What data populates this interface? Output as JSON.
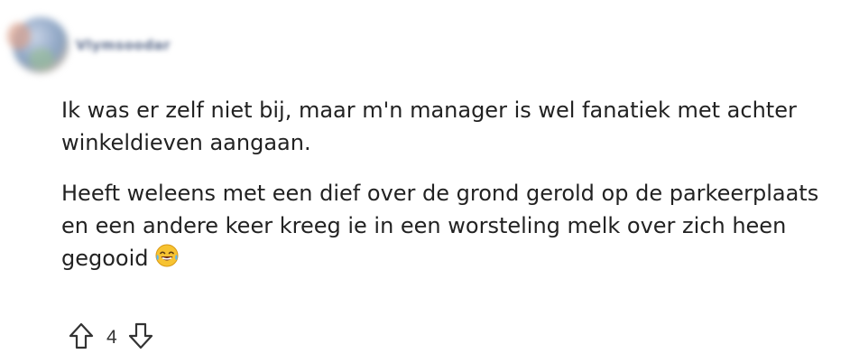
{
  "comment": {
    "author": {
      "username": "Vlymsoodar",
      "avatar_icon": "user-avatar-icon"
    },
    "paragraphs": [
      "Ik was er zelf niet bij, maar m'n manager is wel fanatiek met achter winkeldieven aangaan.",
      "Heeft weleens met een dief over de grond gerold op de parkeerplaats en een andere keer kreeg ie in een worsteling melk over zich heen gegooid"
    ],
    "emoji": "face-with-tears-of-joy",
    "vote_score": "4",
    "icons": {
      "upvote": "upvote-arrow-icon",
      "downvote": "downvote-arrow-icon"
    }
  }
}
